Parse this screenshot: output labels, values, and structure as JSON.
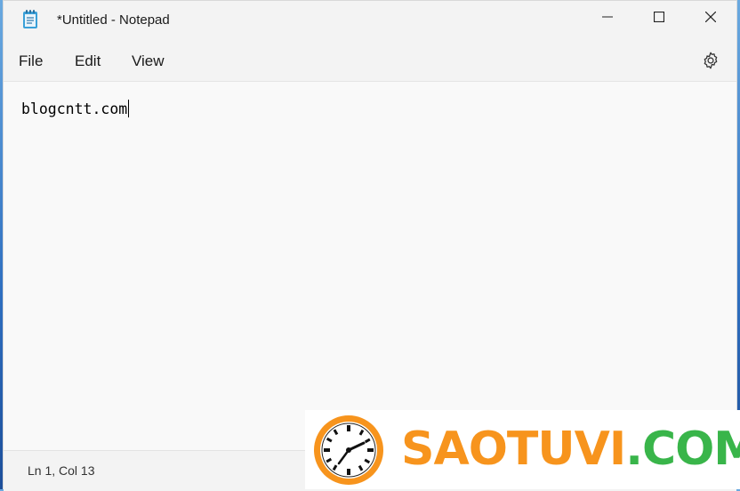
{
  "window": {
    "title": "*Untitled - Notepad"
  },
  "menu": {
    "items": [
      "File",
      "Edit",
      "View"
    ]
  },
  "editor": {
    "content": "blogcntt.com"
  },
  "status": {
    "position": "Ln 1, Col 13"
  },
  "watermark": {
    "part1": "SAOTUVI",
    "part2": ".COM"
  },
  "icons": {
    "app": "notepad-icon",
    "minimize": "minimize-icon",
    "maximize": "maximize-icon",
    "close": "close-icon",
    "settings": "gear-icon"
  },
  "colors": {
    "watermark_orange": "#f7941d",
    "watermark_green": "#39b54a"
  }
}
